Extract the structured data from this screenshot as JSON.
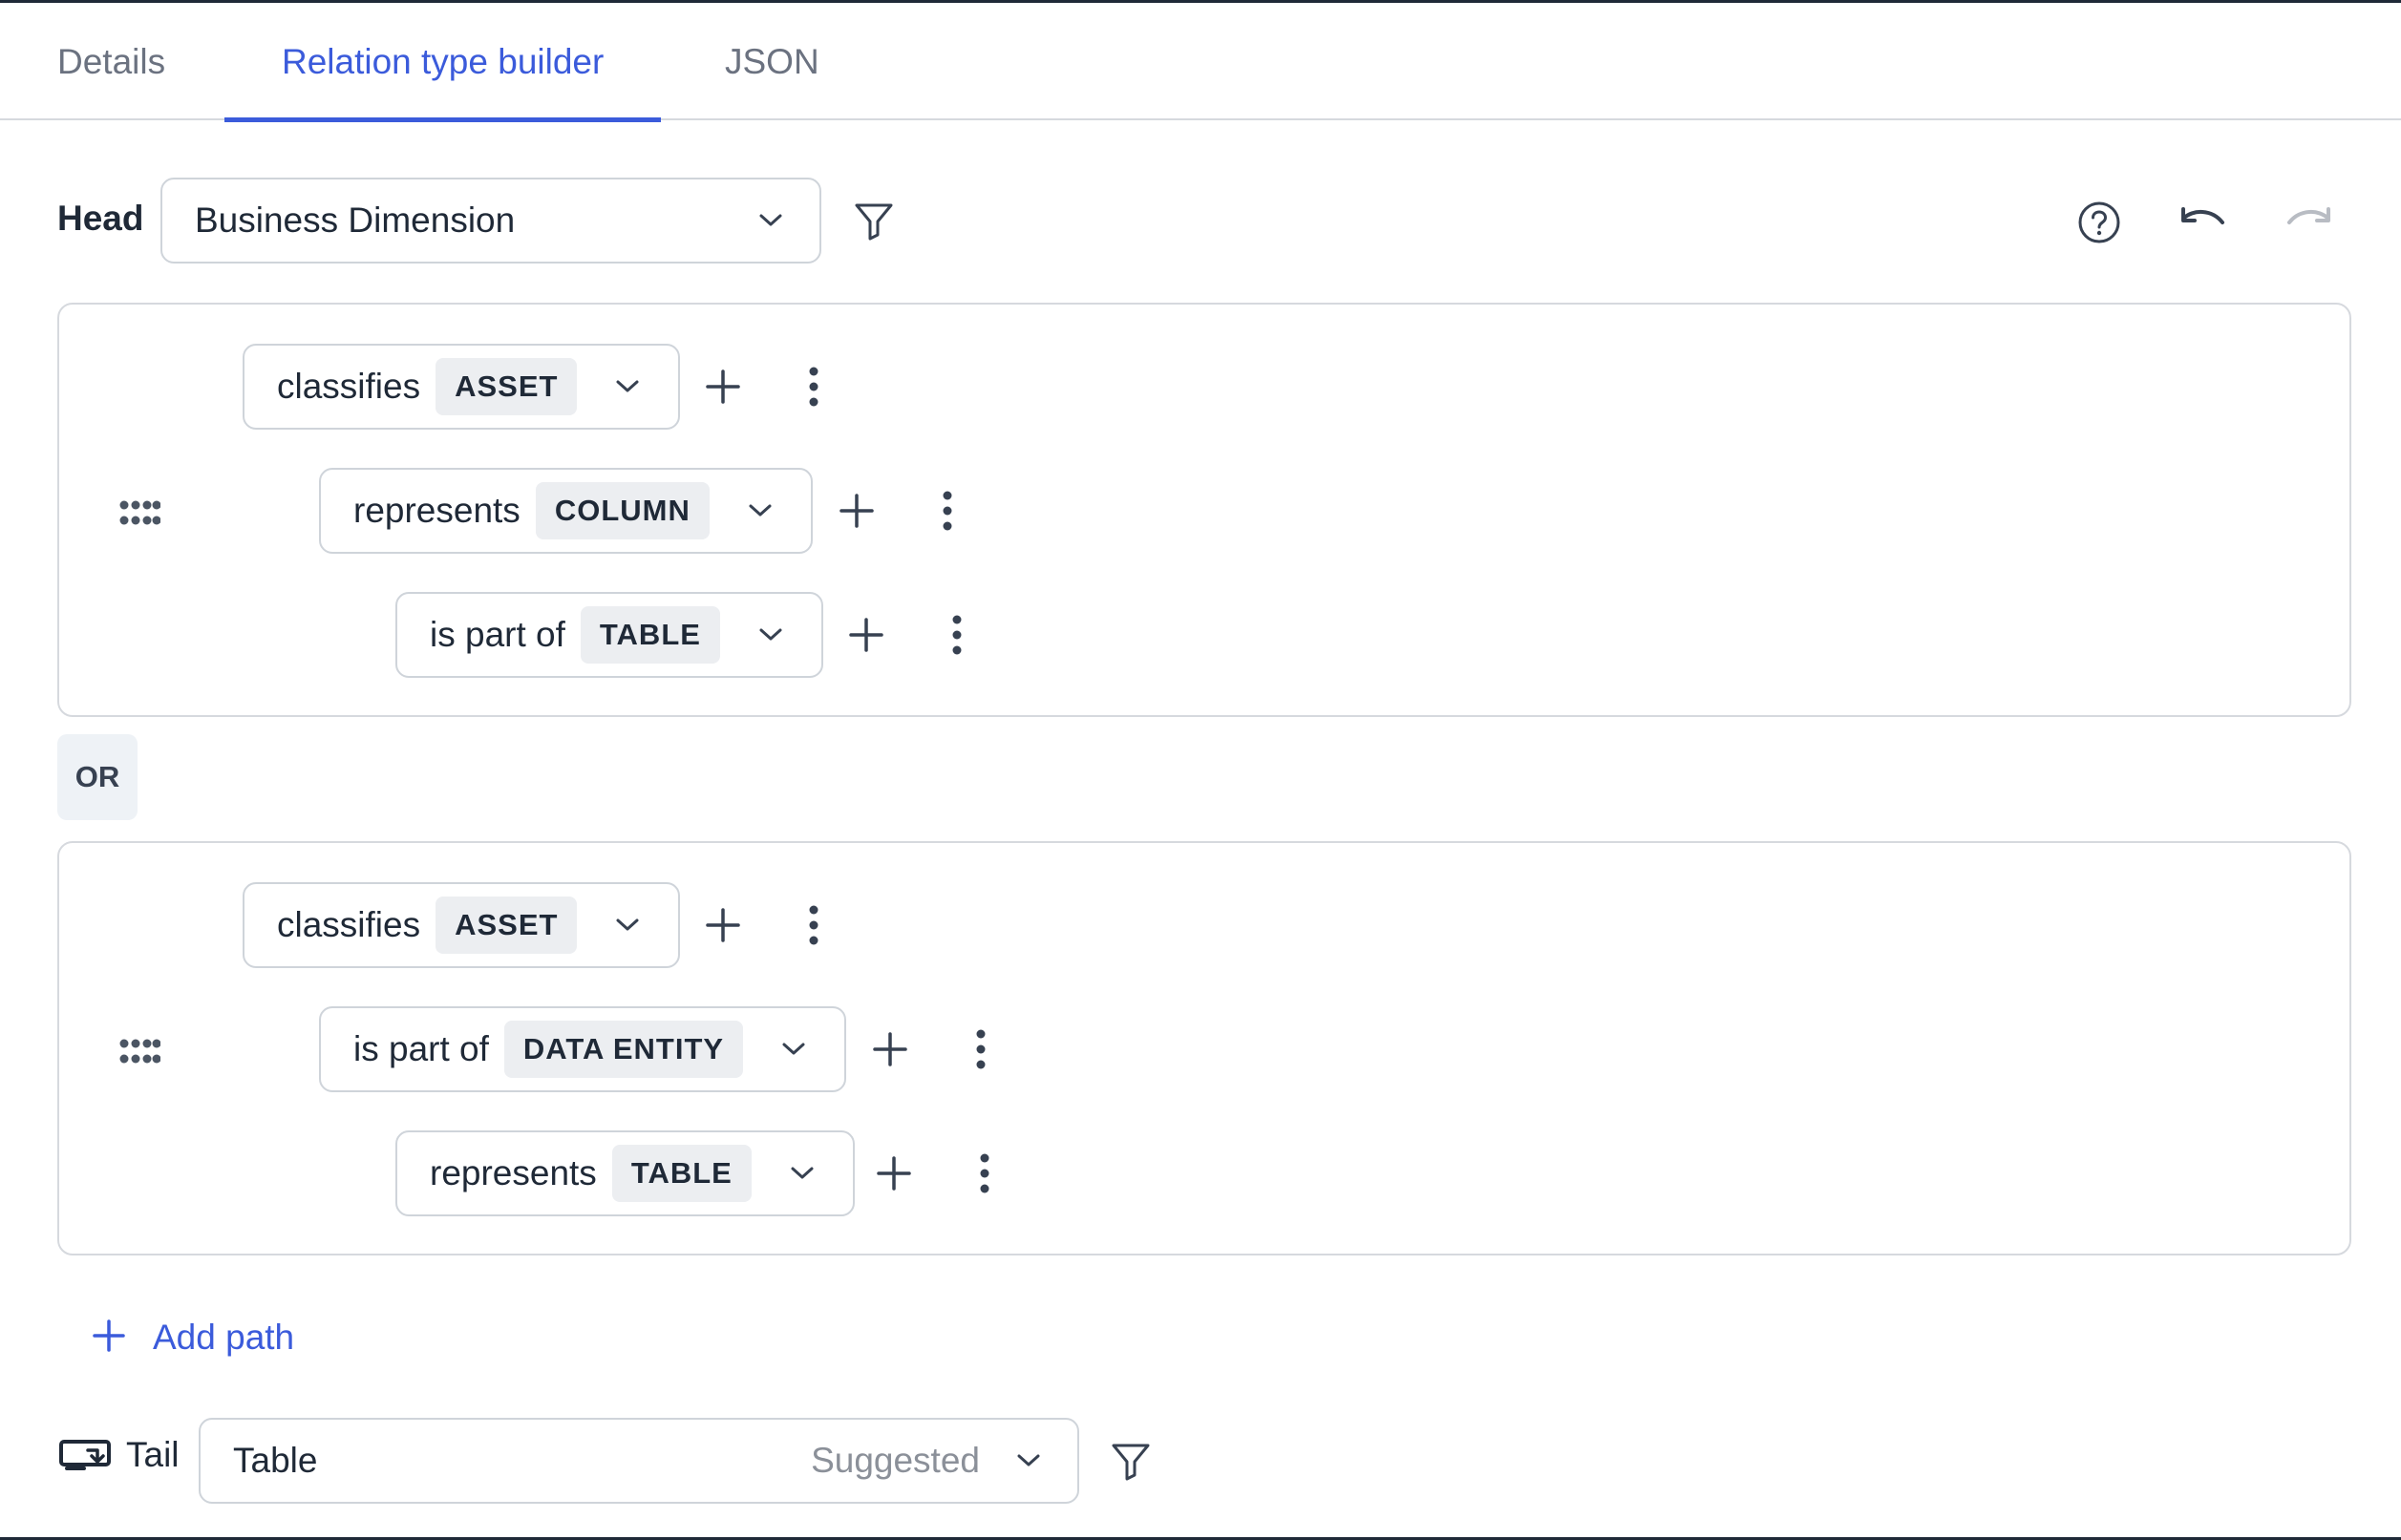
{
  "tabs": [
    {
      "label": "Details"
    },
    {
      "label": "Relation type builder"
    },
    {
      "label": "JSON"
    }
  ],
  "head": {
    "label": "Head",
    "value": "Business Dimension"
  },
  "or_label": "OR",
  "paths": [
    {
      "steps": [
        {
          "relation": "classifies",
          "type": "ASSET"
        },
        {
          "relation": "represents",
          "type": "COLUMN"
        },
        {
          "relation": "is part of",
          "type": "TABLE"
        }
      ]
    },
    {
      "steps": [
        {
          "relation": "classifies",
          "type": "ASSET"
        },
        {
          "relation": "is part of",
          "type": "DATA ENTITY"
        },
        {
          "relation": "represents",
          "type": "TABLE"
        }
      ]
    }
  ],
  "add_path_label": "Add path",
  "tail": {
    "label": "Tail",
    "value": "Table",
    "hint": "Suggested"
  },
  "colors": {
    "accent": "#3b5bdb",
    "border": "#cfd4da",
    "badge_bg": "#eceef1"
  }
}
